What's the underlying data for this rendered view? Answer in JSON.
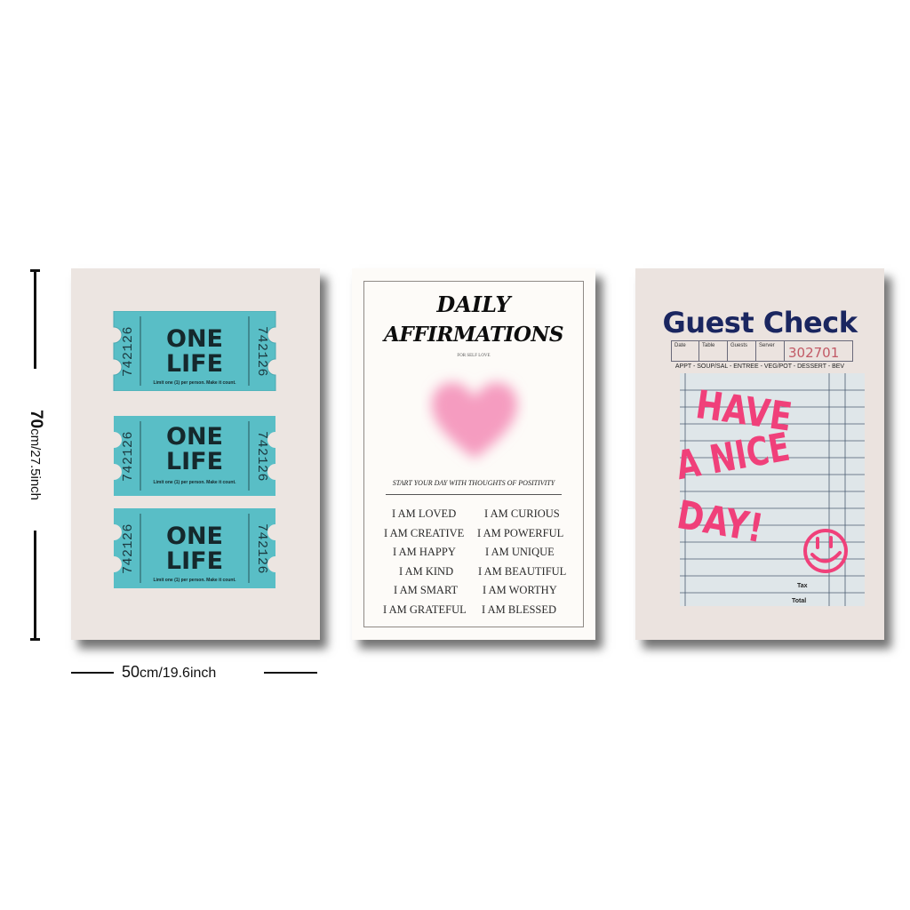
{
  "dimensions": {
    "height_cm": "70",
    "height_rest": "cm/27.5inch",
    "width_cm": "50",
    "width_rest": "cm/19.6inch"
  },
  "poster_ticket": {
    "ticket_color": "#59bec6",
    "number": "742126",
    "line1": "ONE",
    "line2": "LIFE",
    "fine_print": "Limit one (1) per person. Make it count."
  },
  "poster_affirmations": {
    "title_line1": "DAILY",
    "title_line2": "AFFIRMATIONS",
    "subtitle": "FOR SELF LOVE",
    "tagline": "START YOUR DAY WITH THOUGHTS OF POSITIVITY",
    "heart_color": "#f59cc0",
    "left_column": [
      "I AM LOVED",
      "I AM CREATIVE",
      "I AM HAPPY",
      "I AM KIND",
      "I AM SMART",
      "I AM GRATEFUL"
    ],
    "right_column": [
      "I AM CURIOUS",
      "I AM POWERFUL",
      "I AM UNIQUE",
      "I AM BEAUTIFUL",
      "I AM WORTHY",
      "I AM BLESSED"
    ]
  },
  "poster_guest_check": {
    "title": "Guest Check",
    "fields": [
      "Date",
      "Table",
      "Guests",
      "Server"
    ],
    "check_number": "302701",
    "categories": "APPT - SOUP/SAL - ENTREE - VEG/POT - DESSERT - BEV",
    "handwriting": [
      "HAVE",
      "A NICE",
      "DAY!"
    ],
    "smiley_icon": "smiley-face-icon",
    "tax_label": "Tax",
    "total_label": "Total",
    "ink_color": "#f0407a"
  }
}
